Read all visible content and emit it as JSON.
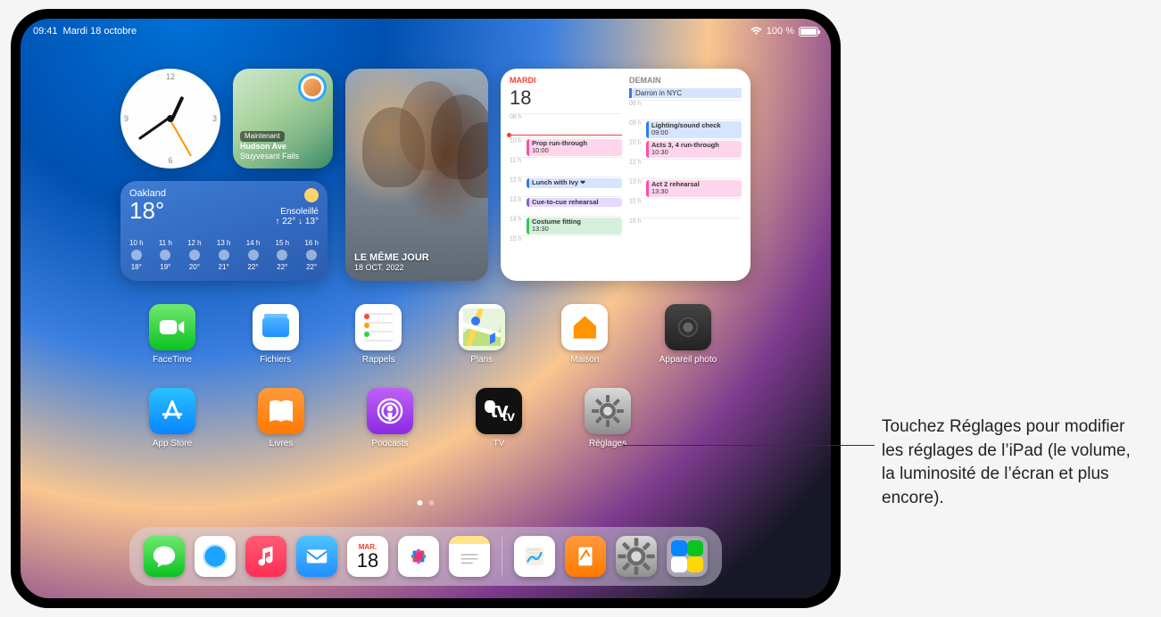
{
  "statusbar": {
    "time": "09:41",
    "date": "Mardi 18 octobre",
    "battery": "100 %"
  },
  "widgets": {
    "maps": {
      "now_badge": "Maintenant",
      "street": "Hudson Ave",
      "city": "Stuyvesant Falls"
    },
    "weather": {
      "city": "Oakland",
      "temp": "18°",
      "condition": "Ensoleillé",
      "hilo": "↑ 22° ↓ 13°",
      "hours": [
        {
          "h": "10 h",
          "icon": "cloud",
          "t": "18°"
        },
        {
          "h": "11 h",
          "icon": "partly",
          "t": "19°"
        },
        {
          "h": "12 h",
          "icon": "sun",
          "t": "20°"
        },
        {
          "h": "13 h",
          "icon": "sun",
          "t": "21°"
        },
        {
          "h": "14 h",
          "icon": "sun",
          "t": "22°"
        },
        {
          "h": "15 h",
          "icon": "sun",
          "t": "22°"
        },
        {
          "h": "16 h",
          "icon": "wind",
          "t": "22°"
        }
      ]
    },
    "photos": {
      "title": "LE MÊME JOUR",
      "date": "18 OCT. 2022"
    },
    "calendar": {
      "today_label": "MARDI",
      "today_num": "18",
      "tomorrow_label": "DEMAIN",
      "tomorrow_allday": "Darron in NYC",
      "today_events": [
        {
          "h": "08 h"
        },
        {
          "h": "10 h",
          "title": "Prop run-through",
          "time": "10:00",
          "cls": "ev-pink"
        },
        {
          "h": "11 h"
        },
        {
          "h": "12 h",
          "title": "Lunch with Ivy",
          "cls": "ev-blue ev-heart"
        },
        {
          "h": "13 h",
          "title": "Cue-to-cue rehearsal",
          "cls": "ev-purple"
        },
        {
          "h": "14 h",
          "title": "Costume fitting",
          "time": "13:30",
          "cls": "ev-green"
        },
        {
          "h": "15 h"
        }
      ],
      "tomorrow_events": [
        {
          "h": "08 h"
        },
        {
          "h": "09 h",
          "title": "Lighting/sound check",
          "time": "09:00",
          "cls": "ev-blue"
        },
        {
          "h": "10 h",
          "title": "Acts 3, 4 run-through",
          "time": "10:30",
          "cls": "ev-pink"
        },
        {
          "h": "12 h"
        },
        {
          "h": "13 h",
          "title": "Act 2 rehearsal",
          "time": "13:30",
          "cls": "ev-pink"
        },
        {
          "h": "15 h"
        },
        {
          "h": "16 h"
        }
      ]
    }
  },
  "apps_row1": [
    {
      "name": "FaceTime",
      "cls": "ic-facetime"
    },
    {
      "name": "Fichiers",
      "cls": "ic-files"
    },
    {
      "name": "Rappels",
      "cls": "ic-reminders"
    },
    {
      "name": "Plans",
      "cls": "ic-maps"
    },
    {
      "name": "Maison",
      "cls": "ic-home"
    },
    {
      "name": "Appareil photo",
      "cls": "ic-camera"
    }
  ],
  "apps_row2": [
    {
      "name": "App Store",
      "cls": "ic-appstore"
    },
    {
      "name": "Livres",
      "cls": "ic-books"
    },
    {
      "name": "Podcasts",
      "cls": "ic-podcasts"
    },
    {
      "name": "TV",
      "cls": "ic-tv"
    },
    {
      "name": "Réglages",
      "cls": "ic-settings"
    }
  ],
  "dock": {
    "main": [
      {
        "name": "Messages",
        "cls": "ic-messages"
      },
      {
        "name": "Safari",
        "cls": "ic-safari"
      },
      {
        "name": "Musique",
        "cls": "ic-music"
      },
      {
        "name": "Mail",
        "cls": "ic-mail"
      },
      {
        "name": "Calendrier",
        "cls": "ic-cal",
        "dow": "MAR.",
        "dn": "18"
      },
      {
        "name": "Photos",
        "cls": "ic-photos"
      },
      {
        "name": "Notes",
        "cls": "ic-notes"
      }
    ],
    "recents": [
      {
        "name": "Freeform",
        "cls": "ic-freeform"
      },
      {
        "name": "Pages",
        "cls": "ic-pages"
      },
      {
        "name": "Réglages",
        "cls": "ic-settings-dock"
      },
      {
        "name": "Bibliothèque d’apps",
        "cls": "ic-applib"
      }
    ]
  },
  "callout": "Touchez Réglages pour modifier les réglages de l’iPad (le volume, la luminosité de l’écran et plus encore)."
}
